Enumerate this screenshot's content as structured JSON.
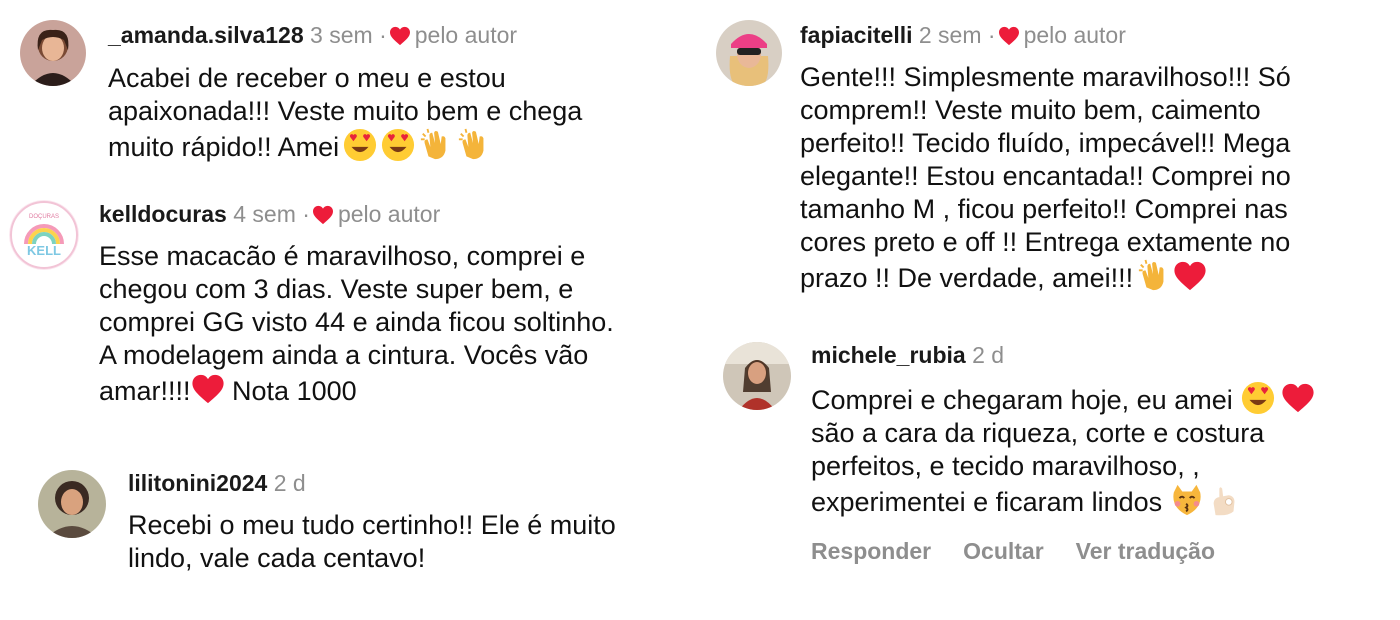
{
  "colors": {
    "heart": "#ed1c3a",
    "muted": "#8e8e8e",
    "text": "#111111"
  },
  "comments": [
    {
      "username": "_amanda.silva128",
      "time": "3 sem",
      "liked_label": "pelo autor",
      "text": "Acabei de receber o meu e estou\napaixonada!!! Veste muito bem e chega\nmuito rápido!! Amei",
      "emojis": [
        "heart-eyes-icon",
        "heart-eyes-icon",
        "clap-icon",
        "clap-icon"
      ]
    },
    {
      "username": "kelldocuras",
      "time": "4 sem",
      "liked_label": "pelo autor",
      "text_a": "Esse macacão é maravilhoso,  comprei e\nchegou com 3 dias. Veste super bem, e\ncomprei GG visto 44 e ainda ficou soltinho.\nA modelagem ainda a cintura. Vocês  vão\namar!!!!",
      "text_b": " Nota 1000",
      "emojis": [
        "red-heart-icon"
      ]
    },
    {
      "username": "lilitonini2024",
      "time": "2 d",
      "text": "Recebi o meu tudo certinho!! Ele é muito\nlindo, vale cada centavo!"
    },
    {
      "username": "fapiacitelli",
      "time": "2 sem",
      "liked_label": "pelo autor",
      "text": "Gente!!! Simplesmente maravilhoso!!! Só\ncomprem!! Veste muito bem, caimento\nperfeito!! Tecido fluído,  impecável!! Mega\nelegante!! Estou encantada!! Comprei no\ntamanho M , ficou perfeito!! Comprei nas\ncores preto e off !! Entrega extamente no\nprazo !! De verdade, amei!!!",
      "emojis": [
        "clap-icon",
        "red-heart-icon"
      ]
    },
    {
      "username": "michele_rubia",
      "time": "2 d",
      "line1": "Comprei e chegaram hoje, eu amei",
      "rest": "são a cara da riqueza, corte e costura\nperfeitos, e tecido maravilhoso, ,\nexperimentei e ficaram lindos",
      "actions": [
        "Responder",
        "Ocultar",
        "Ver tradução"
      ]
    }
  ],
  "avatar_badge": "DOÇURAS"
}
